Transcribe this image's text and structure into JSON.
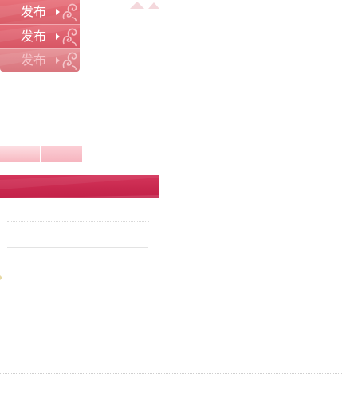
{
  "publish_buttons": [
    {
      "label": "发布",
      "state": "normal"
    },
    {
      "label": "发布",
      "state": "hover"
    },
    {
      "label": "发布",
      "state": "disabled"
    }
  ],
  "icons": {
    "arrow": "arrow-right-icon",
    "swirl": "swirl-ornament-icon",
    "triangle": "triangle-up-icon"
  },
  "colors": {
    "button_pink": "#d95c68",
    "crimson": "#c8284e",
    "tab_pink": "#f7b9c2",
    "triangle_pink": "#f4d8dc",
    "line_gray": "#d9d9d9"
  }
}
